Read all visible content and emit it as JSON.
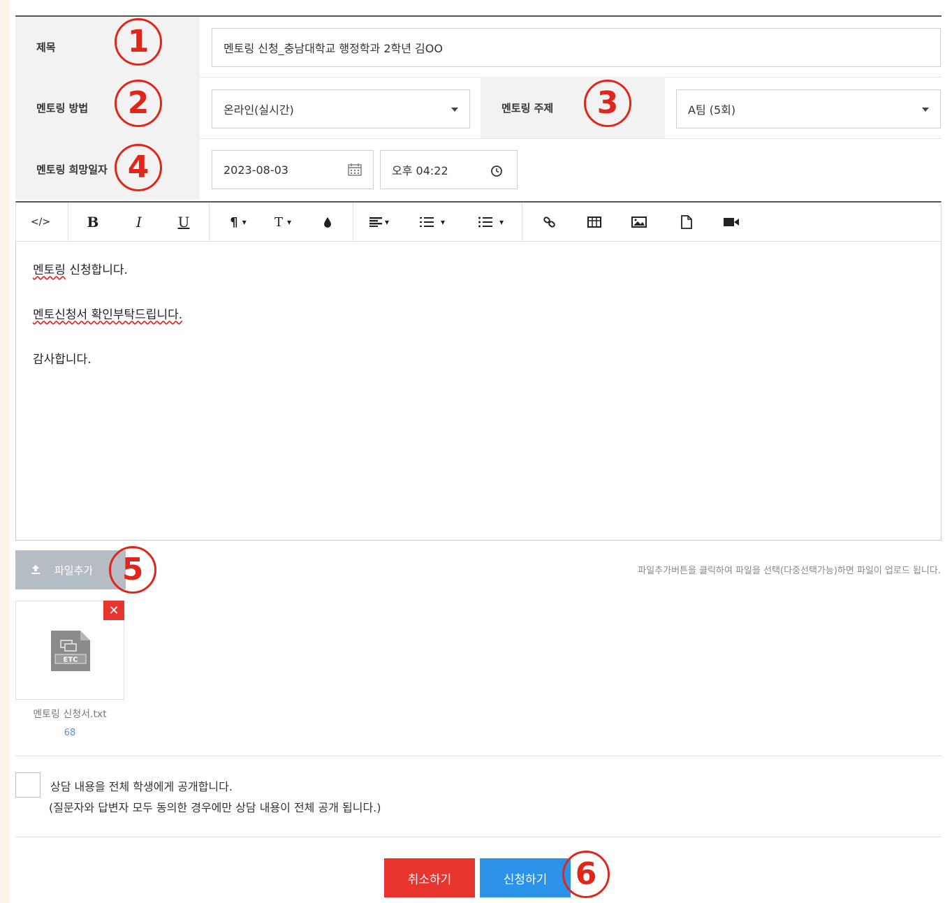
{
  "form": {
    "title_label": "제목",
    "title_value": "멘토링 신청_충남대학교 행정학과 2학년 김OO",
    "method_label": "멘토링 방법",
    "method_value": "온라인(실시간)",
    "topic_label": "멘토링 주제",
    "topic_value": "A팀 (5회)",
    "date_label": "멘토링 희망일자",
    "date_value": "2023-08-03",
    "time_value": "오후 04:22"
  },
  "toolbar": {
    "code": "</>",
    "bold": "B",
    "italic": "I",
    "underline": "U",
    "paragraph": "¶",
    "fontsize": "T",
    "tb_down": "▾"
  },
  "editor": {
    "line1_a": "멘토링",
    "line1_b": " 신청합니다.",
    "line2": "멘토신청서 확인부탁드립니다.",
    "line3": "감사합니다."
  },
  "attachments": {
    "add_button": "파일추가",
    "help_text": "파일추가버튼을 클릭하여 파일을 선택(다중선택가능)하면 파일이 업로드 됩니다.",
    "file_name": "멘토링 신청서.txt",
    "file_size": "68",
    "file_type": "ETC",
    "remove": "✕"
  },
  "agreement": {
    "line1": "상담 내용을 전체 학생에게 공개합니다.",
    "line2": "(질문자와 답변자 모두 동의한 경우에만 상담 내용이 전체 공개 됩니다.)"
  },
  "buttons": {
    "cancel": "취소하기",
    "submit": "신청하기"
  },
  "annotations": {
    "n1": "1",
    "n2": "2",
    "n3": "3",
    "n4": "4",
    "n5": "5",
    "n6": "6"
  },
  "colors": {
    "annotation": "#e0261a",
    "cancel": "#e8342f",
    "submit": "#2a92e8",
    "file_button": "#b6bcc3"
  }
}
